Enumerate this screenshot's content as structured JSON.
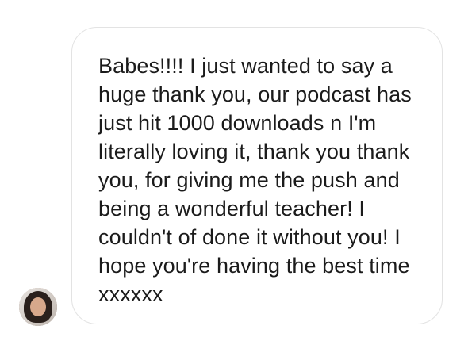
{
  "conversation": {
    "message": {
      "text": "Babes!!!! I just wanted to say a huge thank you, our podcast has just hit 1000 downloads n I'm literally loving it, thank you thank you, for giving me the push and being a wonderful teacher! I couldn't of done it without you! I hope you're having the best time xxxxxx"
    },
    "sender": {
      "avatar_icon": "user-avatar-photo"
    }
  },
  "colors": {
    "background": "#ffffff",
    "bubble_border": "#e3e3e3",
    "text": "#1b1b1b"
  }
}
